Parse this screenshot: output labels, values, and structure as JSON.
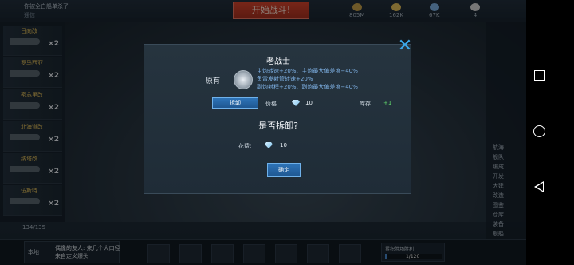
{
  "topbar": {
    "player_name": "你被全白船单杀了",
    "player_sub": "通信",
    "battle_button": "开始战斗!",
    "resources": [
      {
        "icon": "fuel-icon",
        "value": "805M",
        "color": "#c9a24b"
      },
      {
        "icon": "star-icon",
        "value": "162K",
        "color": "#e6c15b"
      },
      {
        "icon": "crate-icon",
        "value": "67K",
        "color": "#7fb2e6"
      },
      {
        "icon": "bulb-icon",
        "value": "4",
        "color": "#d9d9d9"
      }
    ]
  },
  "shiplist": {
    "count": "134/135",
    "ships": [
      {
        "name": "日向改",
        "qty": "×2"
      },
      {
        "name": "罗马西亚",
        "qty": "×2"
      },
      {
        "name": "密苏里改",
        "qty": "×2"
      },
      {
        "name": "北海道改",
        "qty": "×2"
      },
      {
        "name": "纳塔改",
        "qty": "×2"
      },
      {
        "name": "伍斯特",
        "qty": "×2"
      }
    ]
  },
  "right_panel": {
    "labels": [
      "舰队",
      "编成",
      "开发",
      "大建",
      "改造",
      "图鉴",
      "仓库",
      "装备",
      "舰船",
      "航海"
    ]
  },
  "chat": {
    "channel": "本地",
    "message": "偶像的友人: 来几个大口径来自定义爆头"
  },
  "progress": {
    "label": "累积胜场胜利",
    "value": "1/120",
    "fraction": 0.008
  },
  "dialog": {
    "title": "老战士",
    "original_label": "原有",
    "effects": [
      "主炮转速+20%、主炮最大偏差度−40%",
      "鱼雷发射管转速+20%",
      "副炮射程+20%、副炮最大偏差度−40%"
    ],
    "dismantle_label": "拆卸",
    "price_label": "价格",
    "price_value": "10",
    "stock_label": "库存",
    "stock_value": "+1",
    "question": "是否拆卸?",
    "cost_label": "花费:",
    "cost_value": "10",
    "confirm_label": "确定",
    "close_symbol": "✕"
  }
}
